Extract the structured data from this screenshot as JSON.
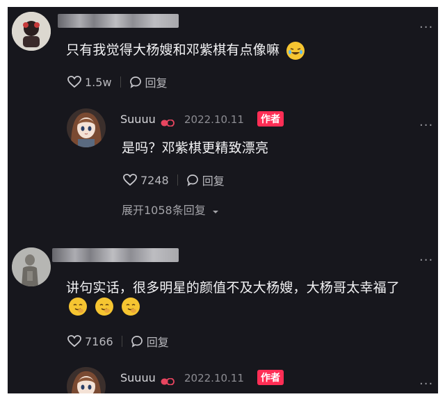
{
  "comments": [
    {
      "text": "只有我觉得大杨嫂和邓紫棋有点像嘛",
      "likes": "1.5w",
      "reply_label": "回复",
      "more": "...",
      "reply": {
        "username": "Suuuu",
        "date": "2022.10.11",
        "badge": "作者",
        "text": "是吗？邓紫棋更精致漂亮",
        "likes": "7248",
        "reply_label": "回复",
        "more": "...",
        "expand": "展开1058条回复"
      }
    },
    {
      "text": "讲句实话，很多明星的颜值不及大杨嫂，大杨哥太幸福了",
      "likes": "7166",
      "reply_label": "回复",
      "more": "...",
      "reply": {
        "username": "Suuuu",
        "date": "2022.10.11",
        "badge": "作者",
        "more": "..."
      }
    }
  ],
  "colors": {
    "background": "#17171d",
    "badge": "#ff2e55",
    "text": "#f3f3f5"
  }
}
